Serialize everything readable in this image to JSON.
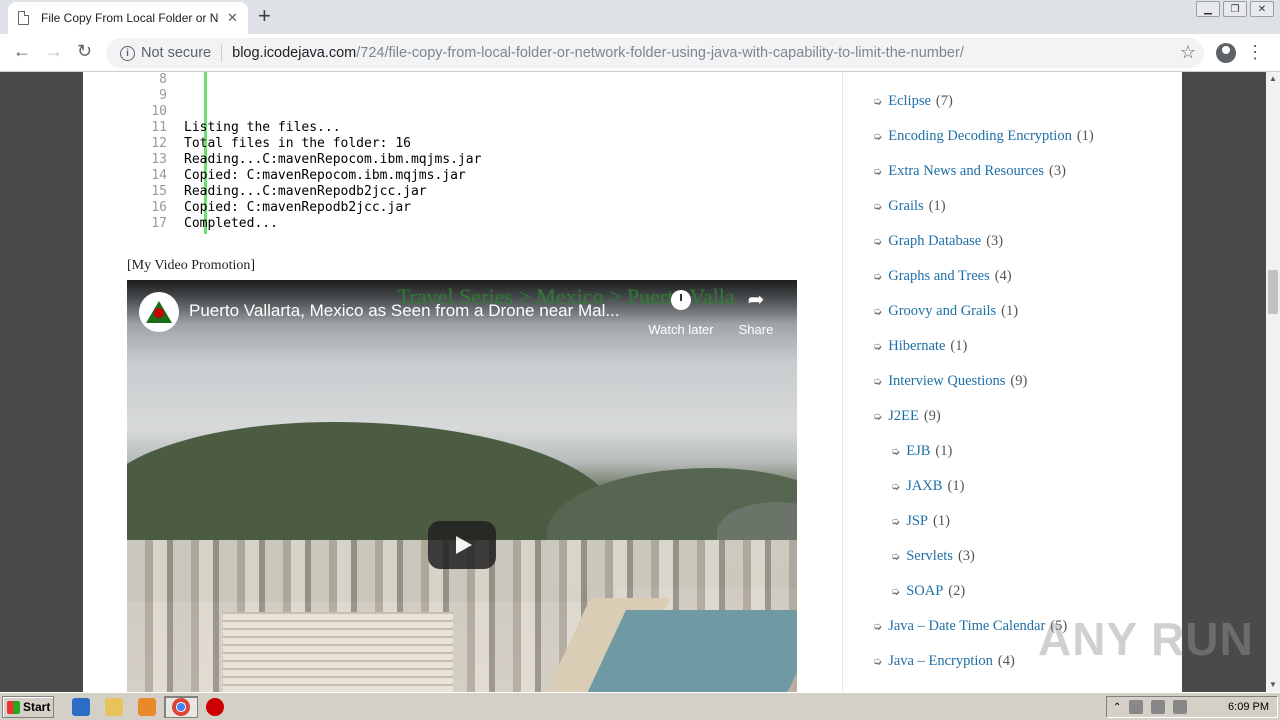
{
  "browser": {
    "tab_title": "File Copy From Local Folder or Network",
    "new_tab": "+",
    "not_secure": "Not secure",
    "url_host": "blog.icodejava.com",
    "url_path": "/724/file-copy-from-local-folder-or-network-folder-using-java-with-capability-to-limit-the-number/"
  },
  "code": {
    "line_numbers": [
      "8",
      "9",
      "10",
      "11",
      "12",
      "13",
      "14",
      "15",
      "16",
      "17"
    ],
    "lines": [
      "",
      "",
      "",
      "Listing the files...",
      "Total files in the folder: 16",
      "Reading...C:mavenRepocom.ibm.mqjms.jar",
      "Copied: C:mavenRepocom.ibm.mqjms.jar",
      "Reading...C:mavenRepodb2jcc.jar",
      "Copied: C:mavenRepodb2jcc.jar",
      "Completed..."
    ]
  },
  "promo_label": "[My Video Promotion]",
  "video": {
    "title": "Puerto Vallarta, Mexico as Seen from a Drone near Mal...",
    "banner": "Travel Series > Mexico > Puerto Valla",
    "watch_later": "Watch later",
    "share": "Share"
  },
  "categories": [
    {
      "name": "Eclipse",
      "count": "(7)",
      "sub": false
    },
    {
      "name": "Encoding Decoding Encryption",
      "count": "(1)",
      "sub": false
    },
    {
      "name": "Extra News and Resources",
      "count": "(3)",
      "sub": false
    },
    {
      "name": "Grails",
      "count": "(1)",
      "sub": false
    },
    {
      "name": "Graph Database",
      "count": "(3)",
      "sub": false
    },
    {
      "name": "Graphs and Trees",
      "count": "(4)",
      "sub": false
    },
    {
      "name": "Groovy and Grails",
      "count": "(1)",
      "sub": false
    },
    {
      "name": "Hibernate",
      "count": "(1)",
      "sub": false
    },
    {
      "name": "Interview Questions",
      "count": "(9)",
      "sub": false
    },
    {
      "name": "J2EE",
      "count": "(9)",
      "sub": false
    },
    {
      "name": "EJB",
      "count": "(1)",
      "sub": true
    },
    {
      "name": "JAXB",
      "count": "(1)",
      "sub": true
    },
    {
      "name": "JSP",
      "count": "(1)",
      "sub": true
    },
    {
      "name": "Servlets",
      "count": "(3)",
      "sub": true
    },
    {
      "name": "SOAP",
      "count": "(2)",
      "sub": true
    },
    {
      "name": "Java – Date Time Calendar",
      "count": "(5)",
      "sub": false
    },
    {
      "name": "Java – Encryption",
      "count": "(4)",
      "sub": false
    }
  ],
  "watermark": "ANY RUN",
  "taskbar": {
    "start": "Start",
    "time": "6:09 PM"
  },
  "colors": {
    "link": "#1e6fa8",
    "code_bar": "#6ce26c"
  }
}
